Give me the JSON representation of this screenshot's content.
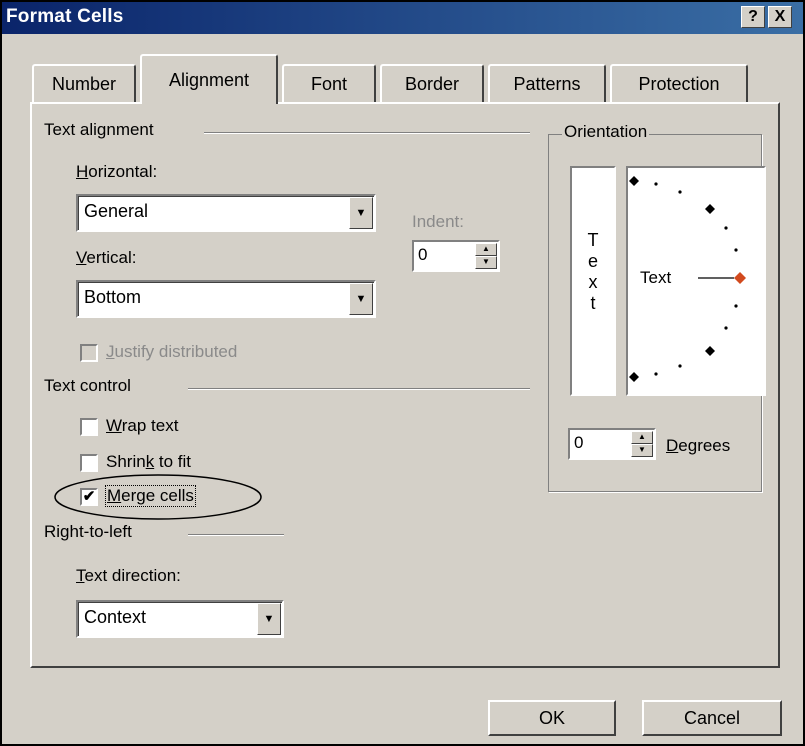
{
  "window": {
    "title": "Format Cells",
    "help_label": "?",
    "close_label": "X"
  },
  "tabs": [
    {
      "label": "Number"
    },
    {
      "label": "Alignment"
    },
    {
      "label": "Font"
    },
    {
      "label": "Border"
    },
    {
      "label": "Patterns"
    },
    {
      "label": "Protection"
    }
  ],
  "active_tab": "Alignment",
  "text_alignment": {
    "group_label": "Text alignment",
    "horizontal": {
      "label_u": "H",
      "label_rest": "orizontal:",
      "value": "General"
    },
    "vertical": {
      "label_u": "V",
      "label_rest": "ertical:",
      "value": "Bottom"
    },
    "indent": {
      "label": "Indent:",
      "value": "0"
    },
    "justify_distributed": {
      "label_u": "J",
      "label_rest": "ustify distributed",
      "checked": false,
      "enabled": false
    }
  },
  "text_control": {
    "group_label": "Text control",
    "wrap_text": {
      "label_u": "W",
      "label_rest": "rap text",
      "checked": false
    },
    "shrink_to_fit": {
      "label_pre": "Shrin",
      "label_u": "k",
      "label_rest": " to fit",
      "checked": false
    },
    "merge_cells": {
      "label_u": "M",
      "label_rest": "erge cells",
      "checked": true,
      "check_glyph": "✔"
    }
  },
  "right_to_left": {
    "group_label": "Right-to-left",
    "text_direction": {
      "label_u": "T",
      "label_rest": "ext direction:",
      "value": "Context"
    }
  },
  "orientation": {
    "group_label": "Orientation",
    "vertical_text": "T\ne\nx\nt",
    "dial_text": "Text",
    "degrees_value": "0",
    "degrees_label_u": "D",
    "degrees_label_rest": "egrees",
    "selected_color": "#d24a1e"
  },
  "buttons": {
    "ok": "OK",
    "cancel": "Cancel"
  },
  "annotation_color": "#000000"
}
